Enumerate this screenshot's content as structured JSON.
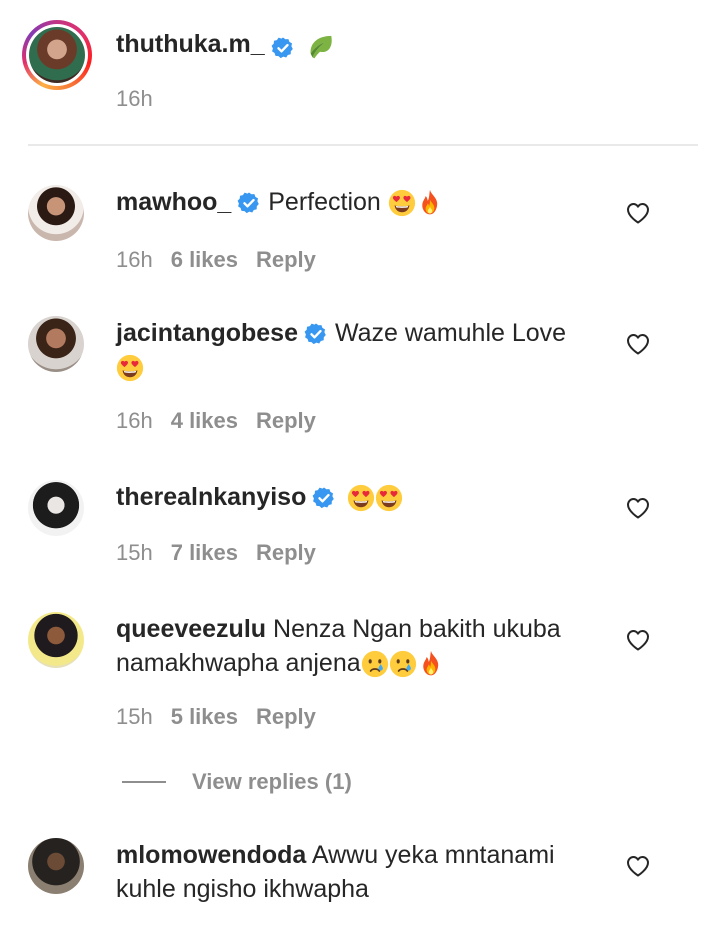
{
  "caption": {
    "username": "thuthuka.m_",
    "time": "16h"
  },
  "comments": [
    {
      "username": "mawhoo_",
      "text": "Perfection",
      "time": "16h",
      "likes": "6 likes",
      "reply": "Reply"
    },
    {
      "username": "jacintangobese",
      "text": "Waze wamuhle Love",
      "time": "16h",
      "likes": "4 likes",
      "reply": "Reply"
    },
    {
      "username": "therealnkanyiso",
      "text": "",
      "time": "15h",
      "likes": "7 likes",
      "reply": "Reply"
    },
    {
      "username": "queeveezulu",
      "text": "Nenza Ngan bakith ukuba namakhwapha anjena",
      "time": "15h",
      "likes": "5 likes",
      "reply": "Reply"
    },
    {
      "username": "mlomowendoda",
      "text": "Awwu yeka mntanami kuhle ngisho ikhwapha"
    }
  ],
  "view_replies": "View replies (1)",
  "colors": {
    "verified": "#3897f0",
    "secondary_text": "#8e8e8e",
    "primary_text": "#262626"
  },
  "icons": [
    "verified-icon",
    "leaf-emoji-icon",
    "heart-eyes-emoji-icon",
    "fire-emoji-icon",
    "crying-emoji-icon",
    "heart-outline-icon"
  ]
}
